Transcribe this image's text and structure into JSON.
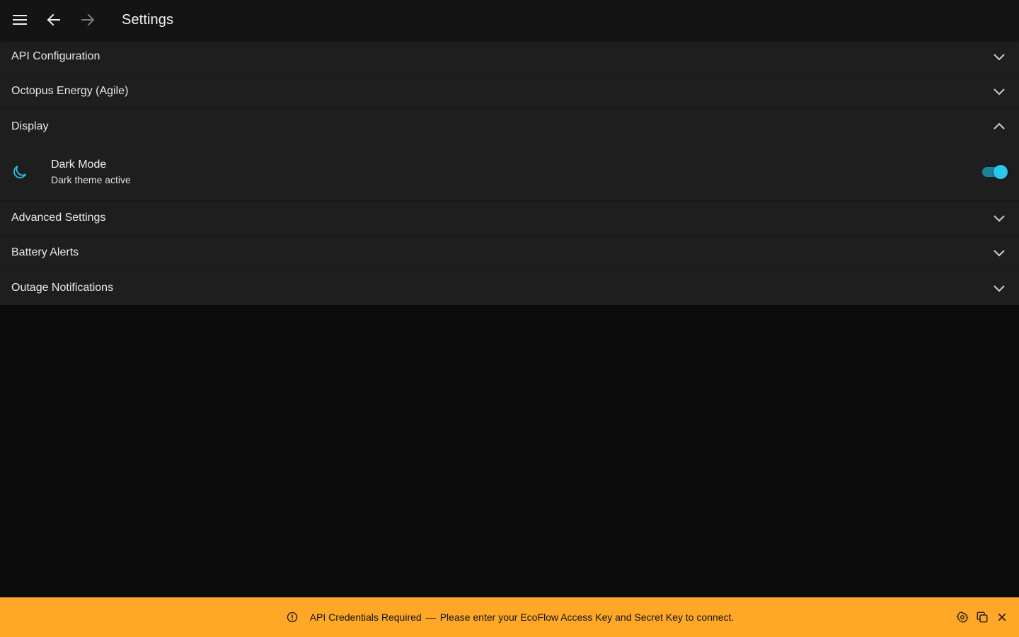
{
  "appbar": {
    "menu_icon": "menu-icon",
    "back_icon": "arrow-back-icon",
    "forward_icon": "arrow-forward-icon",
    "title": "Settings"
  },
  "panels": [
    {
      "label": "API Configuration",
      "expanded": false
    },
    {
      "label": "Octopus Energy (Agile)",
      "expanded": false
    },
    {
      "label": "Display",
      "expanded": true
    },
    {
      "label": "Advanced Settings",
      "expanded": false
    },
    {
      "label": "Battery Alerts",
      "expanded": false
    },
    {
      "label": "Outage Notifications",
      "expanded": false
    }
  ],
  "display": {
    "dark_mode": {
      "icon": "moon-icon",
      "title": "Dark Mode",
      "subtitle": "Dark theme active",
      "enabled": true
    }
  },
  "banner": {
    "icon": "warning-circle-icon",
    "title": "API Credentials Required",
    "separator": "—",
    "message": "Please enter your EcoFlow Access Key and Secret Key to connect.",
    "actions": [
      "settings-icon",
      "copy-icon",
      "close-icon"
    ]
  },
  "colors": {
    "accent": "#29c6ee",
    "banner": "#ffa726",
    "panel": "#1e1e1e",
    "appbar": "#141414",
    "background": "#0c0c0c"
  }
}
